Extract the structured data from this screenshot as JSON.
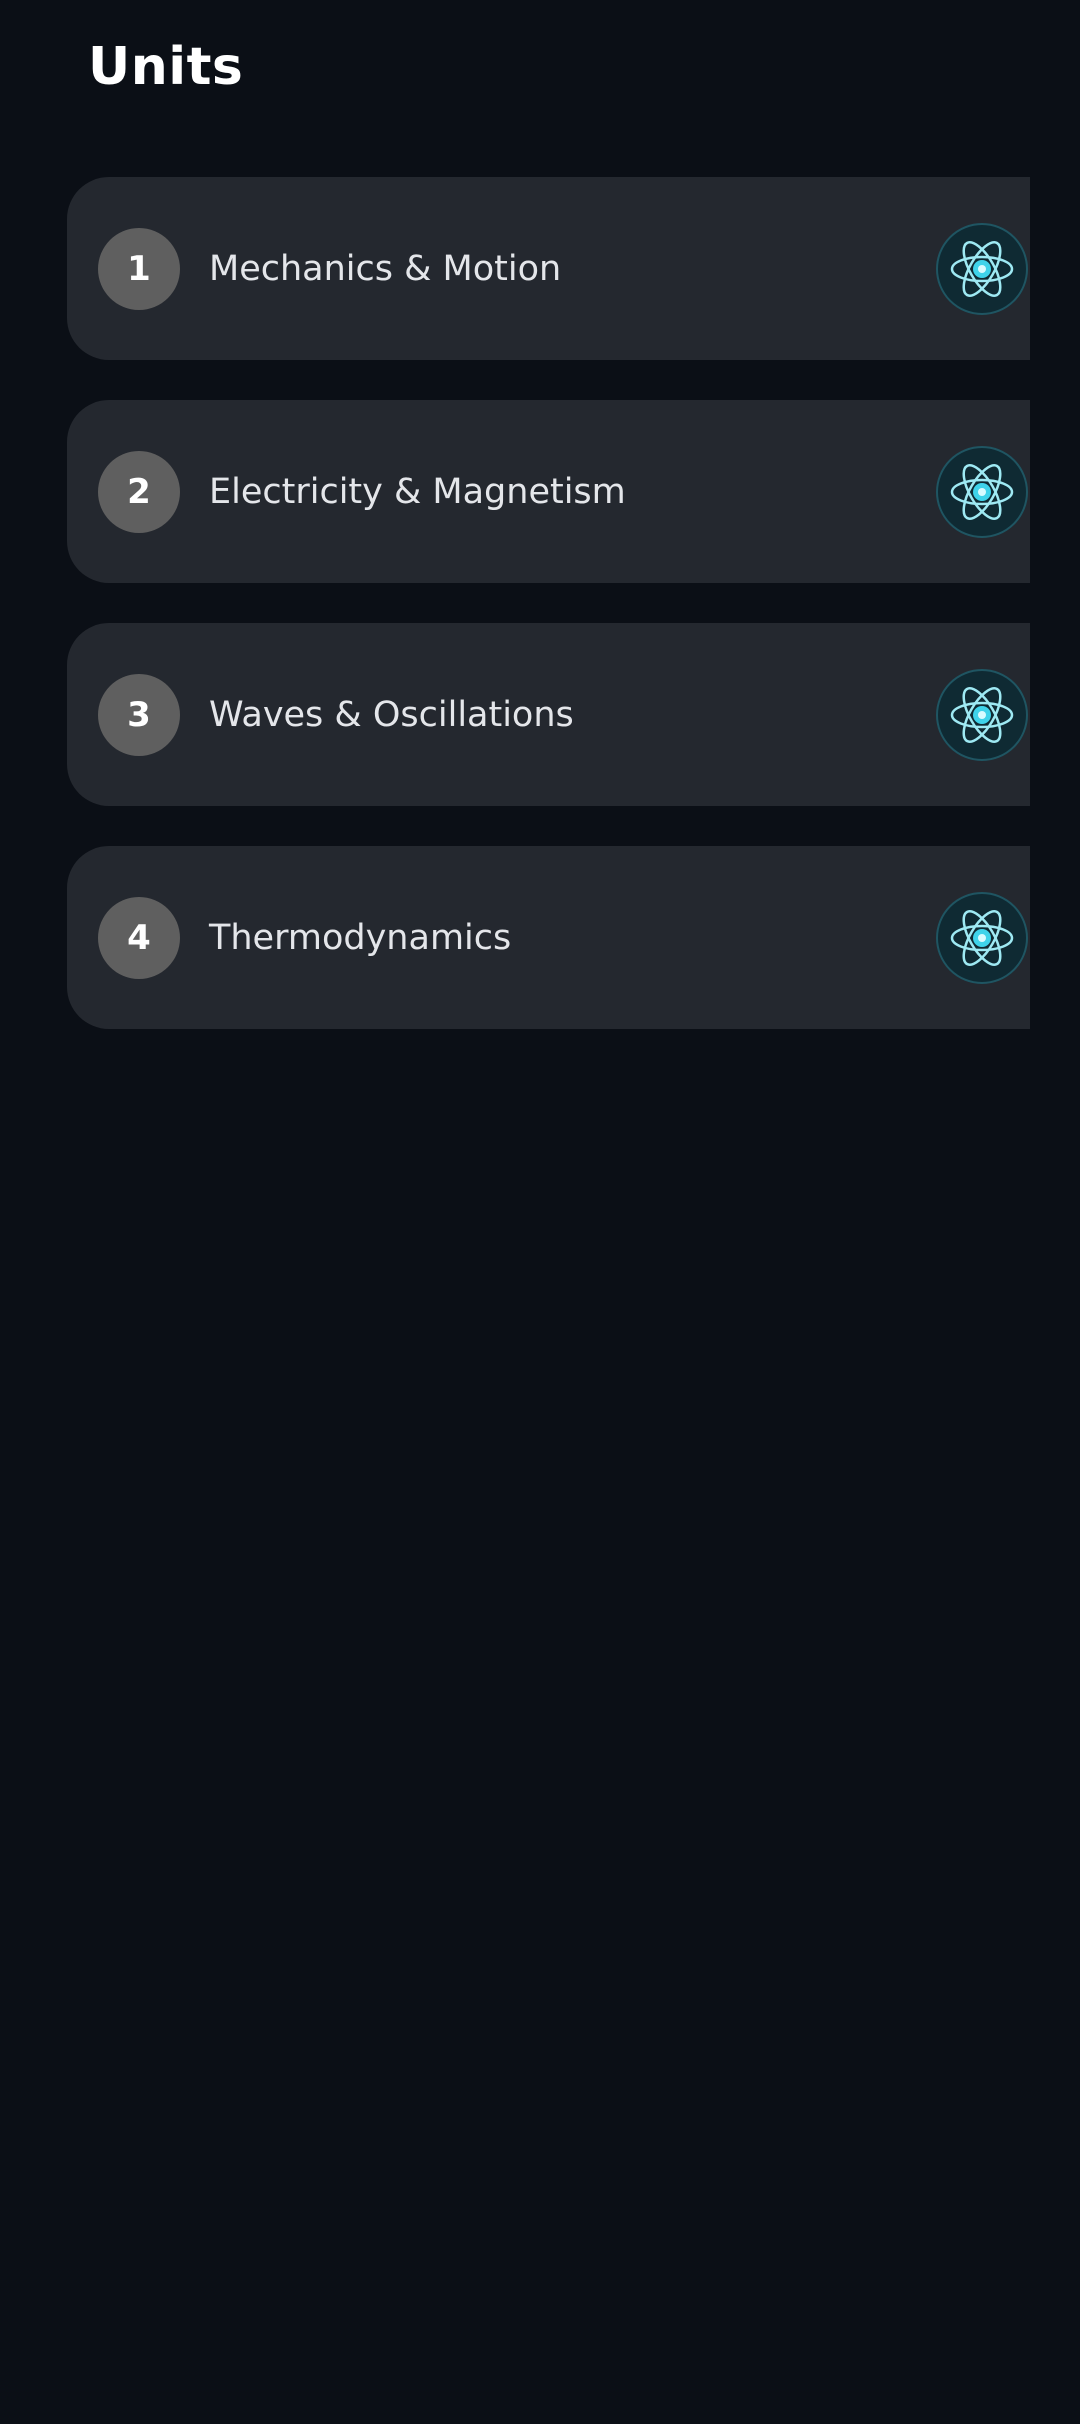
{
  "header": {
    "title": "Units"
  },
  "units": [
    {
      "number": "1",
      "title": "Mechanics & Motion",
      "icon": "atom-icon"
    },
    {
      "number": "2",
      "title": "Electricity & Magnetism",
      "icon": "atom-icon"
    },
    {
      "number": "3",
      "title": "Waves & Oscillations",
      "icon": "atom-icon"
    },
    {
      "number": "4",
      "title": "Thermodynamics",
      "icon": "atom-icon"
    }
  ],
  "colors": {
    "background": "#0b0f16",
    "card": "#24282f",
    "number_badge": "#5f5f5f",
    "accent": "#3fd3ea"
  }
}
